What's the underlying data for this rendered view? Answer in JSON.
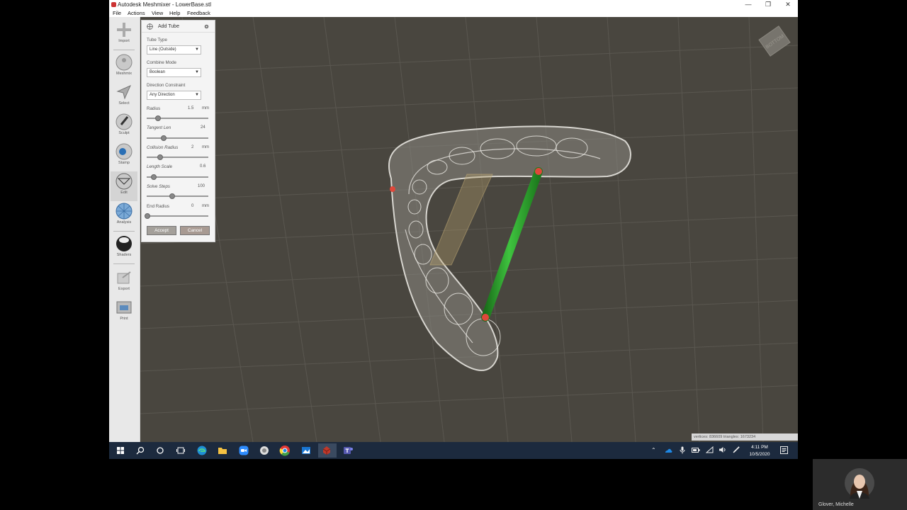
{
  "window": {
    "title": "Autodesk Meshmixer - LowerBase.stl",
    "minimize": "—",
    "restore": "❐",
    "close": "✕"
  },
  "menu": {
    "file": "File",
    "actions": "Actions",
    "view": "View",
    "help": "Help",
    "feedback": "Feedback"
  },
  "tools": [
    {
      "label": "Import",
      "icon": "plus-icon"
    },
    {
      "label": "Meshmix",
      "icon": "meshmix-icon"
    },
    {
      "label": "Select",
      "icon": "select-arrow-icon"
    },
    {
      "label": "Sculpt",
      "icon": "brush-icon"
    },
    {
      "label": "Stamp",
      "icon": "stamp-icon"
    },
    {
      "label": "Edit",
      "icon": "edit-icon"
    },
    {
      "label": "Analysis",
      "icon": "analysis-icon"
    },
    {
      "label": "Shaders",
      "icon": "shader-sphere-icon"
    },
    {
      "label": "Export",
      "icon": "export-icon"
    },
    {
      "label": "Print",
      "icon": "printer-icon"
    }
  ],
  "panel": {
    "title": "Add Tube",
    "tube_type_label": "Tube Type",
    "tube_type_value": "Line (Outside)",
    "combine_mode_label": "Combine Mode",
    "combine_mode_value": "Boolean",
    "direction_label": "Direction Constraint",
    "direction_value": "Any Direction",
    "radius_label": "Radius",
    "radius_value": "1.5",
    "radius_unit": "mm",
    "radius_fraction": 0.17,
    "tangent_label": "Tangent Len",
    "tangent_value": "24",
    "tangent_fraction": 0.26,
    "collision_label": "Collision Radius",
    "collision_value": "2",
    "collision_unit": "mm",
    "collision_fraction": 0.21,
    "length_label": "Length Scale",
    "length_value": "0.6",
    "length_fraction": 0.1,
    "solve_label": "Solve Steps",
    "solve_value": "100",
    "solve_fraction": 0.4,
    "end_label": "End Radius",
    "end_value": "0",
    "end_unit": "mm",
    "end_fraction": 0.0,
    "accept_label": "Accept",
    "cancel_label": "Cancel"
  },
  "viewcube": {
    "label": "BOTTOM"
  },
  "status": {
    "text": "vertices: 836609 triangles: 1673234"
  },
  "taskbar": {
    "time": "4:11 PM",
    "date": "10/5/2020",
    "apps": [
      "start-icon",
      "search-icon",
      "cortana-icon",
      "task-view-icon",
      "edge-icon",
      "file-explorer-icon",
      "zoom-icon",
      "app-icon",
      "chrome-icon",
      "photos-icon",
      "meshmixer-icon",
      "teams-icon"
    ]
  },
  "participant": {
    "name": "Glover, Michelle"
  },
  "colors": {
    "viewport": "#49463f",
    "tube": "#2e9e2e",
    "endpoint": "#e0473a",
    "taskbar": "#1c2a3e"
  }
}
